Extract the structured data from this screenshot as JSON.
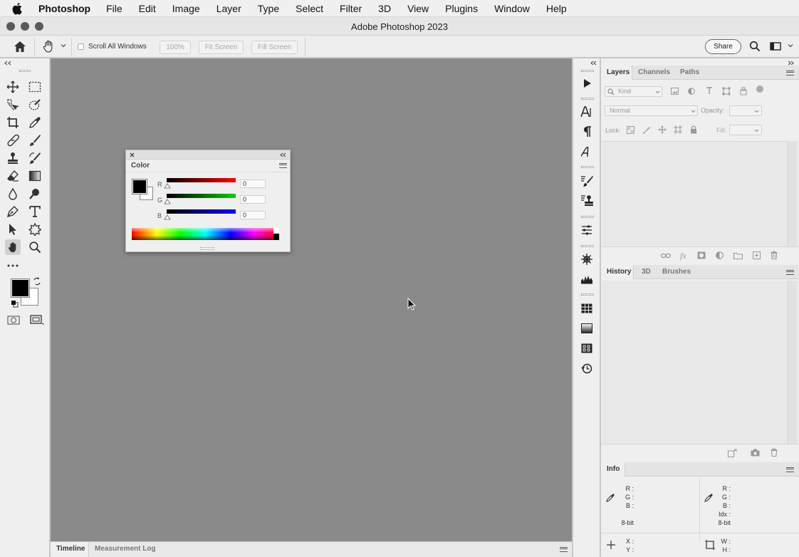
{
  "menubar": {
    "app_name": "Photoshop",
    "items": [
      "File",
      "Edit",
      "Image",
      "Layer",
      "Type",
      "Select",
      "Filter",
      "3D",
      "View",
      "Plugins",
      "Window",
      "Help"
    ]
  },
  "window": {
    "title": "Adobe Photoshop 2023"
  },
  "options_bar": {
    "scroll_all_windows": "Scroll All Windows",
    "zoom_value": "100%",
    "fit_screen": "Fit Screen",
    "fill_screen": "Fill Screen",
    "share": "Share"
  },
  "color_panel": {
    "tab": "Color",
    "sliders": [
      {
        "label": "R",
        "value": "0",
        "color": "#ff0000"
      },
      {
        "label": "G",
        "value": "0",
        "color": "#00d000"
      },
      {
        "label": "B",
        "value": "0",
        "color": "#0000ff"
      }
    ],
    "foreground": "#000000",
    "background": "#ffffff"
  },
  "layers_panel": {
    "tabs": [
      "Layers",
      "Channels",
      "Paths"
    ],
    "kind_placeholder": "Kind",
    "blend_mode": "Normal",
    "opacity_label": "Opacity:",
    "lock_label": "Lock:",
    "fill_label": "Fill:"
  },
  "history_panel": {
    "tabs": [
      "History",
      "3D",
      "Brushes"
    ]
  },
  "info_panel": {
    "tab": "Info",
    "left_rgb": [
      "R :",
      "G :",
      "B :"
    ],
    "left_depth": "8-bit",
    "right_rgb": [
      "R :",
      "G :",
      "B :",
      "Idx :"
    ],
    "right_depth": "8-bit",
    "xy": [
      "X :",
      "Y :"
    ],
    "wh": [
      "W :",
      "H :"
    ]
  },
  "bottom_tabs": [
    "Timeline",
    "Measurement Log"
  ]
}
